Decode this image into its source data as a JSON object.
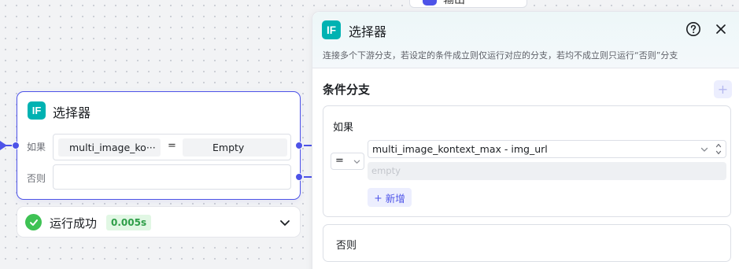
{
  "canvas": {
    "peek_node_label": "输出"
  },
  "node": {
    "badge": "IF",
    "title": "选择器",
    "if_label": "如果",
    "else_label": "否则",
    "condition": {
      "left_chip": "multi_image_ko···",
      "operator": "=",
      "right_chip": "Empty"
    }
  },
  "status": {
    "label": "运行成功",
    "duration": "0.005s"
  },
  "panel": {
    "badge": "IF",
    "title": "选择器",
    "description": "连接多个下游分支，若设定的条件成立则仅运行对应的分支，若均不成立则只运行“否则”分支",
    "section_title": "条件分支",
    "add_branch_label": "+",
    "branch": {
      "label": "如果",
      "operator": "=",
      "variable": "multi_image_kontext_max - img_url",
      "value_placeholder": "empty",
      "add_condition_label": "新增",
      "add_condition_icon": "+"
    },
    "else_label": "否则"
  },
  "colors": {
    "accent": "#4d53e8",
    "if_badge": "#00b2b2",
    "success": "#3ec254"
  }
}
